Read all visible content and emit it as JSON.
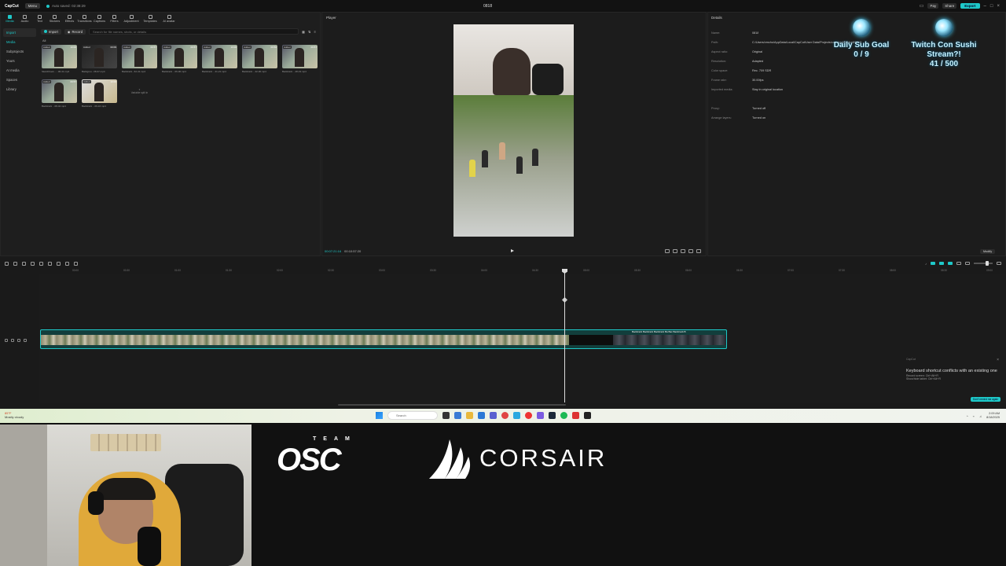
{
  "app": {
    "name": "CapCut",
    "menu_label": "Menu",
    "autosave": "Auto saved: 02:38:29",
    "project_title": "0818",
    "titlebar_right": [
      "Pay",
      "Share",
      "Export"
    ]
  },
  "toolbar": {
    "items": [
      {
        "label": "Media",
        "icon": "media-icon",
        "active": true
      },
      {
        "label": "Audio",
        "icon": "audio-icon"
      },
      {
        "label": "Text",
        "icon": "text-icon"
      },
      {
        "label": "Stickers",
        "icon": "sticker-icon"
      },
      {
        "label": "Effects",
        "icon": "effects-icon"
      },
      {
        "label": "Transitions",
        "icon": "transition-icon"
      },
      {
        "label": "Captions",
        "icon": "caption-icon"
      },
      {
        "label": "Filters",
        "icon": "filter-icon"
      },
      {
        "label": "Adjustment",
        "icon": "adjust-icon"
      },
      {
        "label": "Templates",
        "icon": "template-icon"
      },
      {
        "label": "AI avatar",
        "icon": "avatar-icon"
      }
    ]
  },
  "leftnav": [
    "Import",
    "Media",
    "Subprojects",
    "Yours",
    "AI media",
    "Spaces",
    "Library"
  ],
  "media": {
    "import_label": "Import",
    "record_label": "Record",
    "search_placeholder": "Search for file names, shots, or details",
    "all_label": "All",
    "thumbs": [
      {
        "tag": "Added",
        "dur": "10:00",
        "cap": "Sketchbook - ...06-41.mp4"
      },
      {
        "tag": "Added",
        "dur": "00:09",
        "cap": "Backgrou...08-37.mp4"
      },
      {
        "tag": "Added",
        "dur": "09:57",
        "cap": "Backtrack...62-41.mp4"
      },
      {
        "tag": "Added",
        "dur": "09:57",
        "cap": "Backtrack ...06-00.mp4"
      },
      {
        "tag": "Added",
        "dur": "10:00",
        "cap": "Backtrack ...41-21.mp4"
      },
      {
        "tag": "Added",
        "dur": "09:50",
        "cap": "Backtrack ...42-00.mp4"
      },
      {
        "tag": "Added",
        "dur": "09:57",
        "cap": "Backtrack ...48-19.mp4"
      },
      {
        "tag": "Added",
        "dur": "09:57",
        "cap": "Backtrack ...08-42.mp4"
      },
      {
        "tag": "Added",
        "dur": "10:00",
        "cap": "Backtrack ...09-16.mp4"
      }
    ],
    "placeholder_text": "Variable split in"
  },
  "player": {
    "title": "Player",
    "timecode_current": "00:07:21:16",
    "timecode_total": "00:10:57:20"
  },
  "details": {
    "title": "Details",
    "rows": [
      {
        "k": "Name:",
        "v": "0818"
      },
      {
        "k": "Path:",
        "v": "C:/Users/vmcho/AppData/Local/CapCut/User Data/Projects/com.lveditor.draft/0818"
      },
      {
        "k": "Aspect ratio:",
        "v": "Original"
      },
      {
        "k": "Resolution:",
        "v": "Adapted"
      },
      {
        "k": "Color space:",
        "v": "Rec. 709 SDR"
      },
      {
        "k": "Frame rate:",
        "v": "30.00fps"
      },
      {
        "k": "Imported media:",
        "v": "Stay in original location"
      },
      {
        "k": "",
        "v": ""
      },
      {
        "k": "Proxy:",
        "v": "Turned off"
      },
      {
        "k": "Arrange layers:",
        "v": "Turned on"
      }
    ],
    "modify_label": "Modify"
  },
  "overlay": {
    "goal1_title": "Daily Sub Goal",
    "goal1_value": "0 / 9",
    "goal2_title": "Twitch Con Sushi Stream?!",
    "goal2_value": "41 / 500"
  },
  "timeline": {
    "ruler": [
      "00:00",
      "00:30",
      "01:00",
      "01:30",
      "02:00",
      "02:30",
      "03:00",
      "03:30",
      "04:00",
      "04:30",
      "05:00",
      "05:30",
      "06:00",
      "06:30",
      "07:00",
      "07:30",
      "08:00",
      "08:30",
      "09:00",
      "09:30",
      "10:00",
      "10:30",
      "11:00",
      "11:30",
      "12:00"
    ],
    "clip_labels": "Backtrack  Backtrack  Backtrack  Ba  Bac  Backtrack  B"
  },
  "toast": {
    "brand": "CapCut",
    "title": "Keyboard shortcut conflicts with an existing one",
    "line1": "Record screen: Ctrl+Alt+R",
    "line2": "Show/hide tablet: Ctrl+Alt+R",
    "action": "Don't remind me again"
  },
  "taskbar": {
    "temp": "85°F",
    "weather": "Mostly cloudy",
    "search_placeholder": "Search",
    "time": "2:09 AM",
    "date": "8/18/2025"
  },
  "stream": {
    "team_label": "TEAM",
    "team_name": "OSC",
    "sponsor": "CORSAIR"
  }
}
